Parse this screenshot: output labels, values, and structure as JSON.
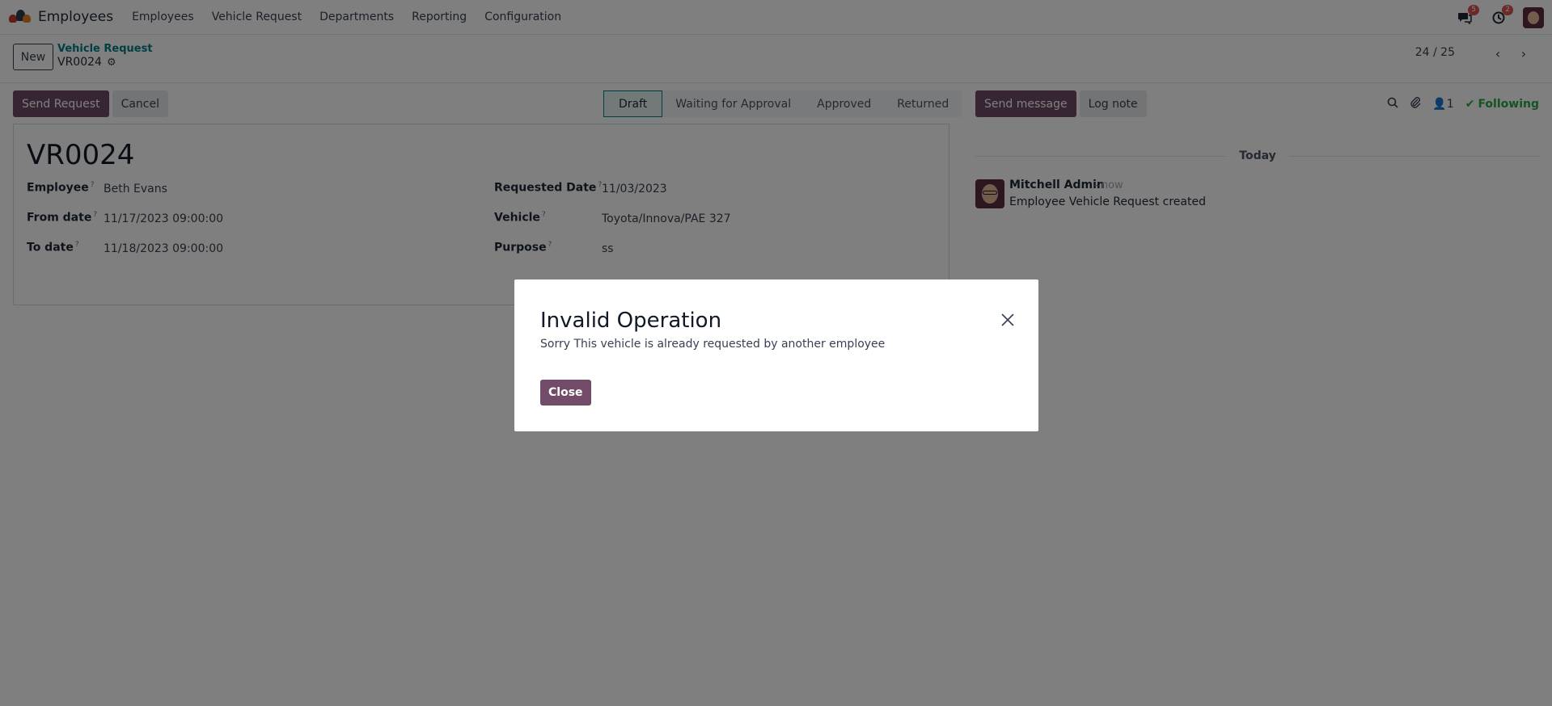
{
  "navbar": {
    "app_name": "Employees",
    "menu": [
      "Employees",
      "Vehicle Request",
      "Departments",
      "Reporting",
      "Configuration"
    ],
    "messages_badge": "5",
    "activities_badge": "2"
  },
  "control": {
    "new_label": "New",
    "breadcrumb": "Vehicle Request",
    "record": "VR0024",
    "pager": "24 / 25"
  },
  "actions": {
    "send_request": "Send Request",
    "cancel": "Cancel"
  },
  "stages": [
    "Draft",
    "Waiting for Approval",
    "Approved",
    "Returned"
  ],
  "active_stage": "Draft",
  "form": {
    "title": "VR0024",
    "help_mark": "?",
    "employee_label": "Employee",
    "employee_value": "Beth Evans",
    "from_date_label": "From date",
    "from_date_value": "11/17/2023 09:00:00",
    "to_date_label": "To date",
    "to_date_value": "11/18/2023 09:00:00",
    "requested_date_label": "Requested Date",
    "requested_date_value": "11/03/2023",
    "vehicle_label": "Vehicle",
    "vehicle_value": "Toyota/Innova/PAE 327",
    "purpose_label": "Purpose",
    "purpose_value": "ss"
  },
  "chatter": {
    "send_message": "Send message",
    "log_note": "Log note",
    "followers_count": "1",
    "following": "Following",
    "separator": "Today",
    "message": {
      "author": "Mitchell Admin",
      "time": "- now",
      "body": "Employee Vehicle Request created"
    }
  },
  "dialog": {
    "title": "Invalid Operation",
    "body": "Sorry This vehicle is already requested by another employee",
    "close": "Close"
  },
  "colors": {
    "primary": "#714b67",
    "link": "#017e84",
    "following": "#28a745",
    "badge": "#d9534f"
  }
}
